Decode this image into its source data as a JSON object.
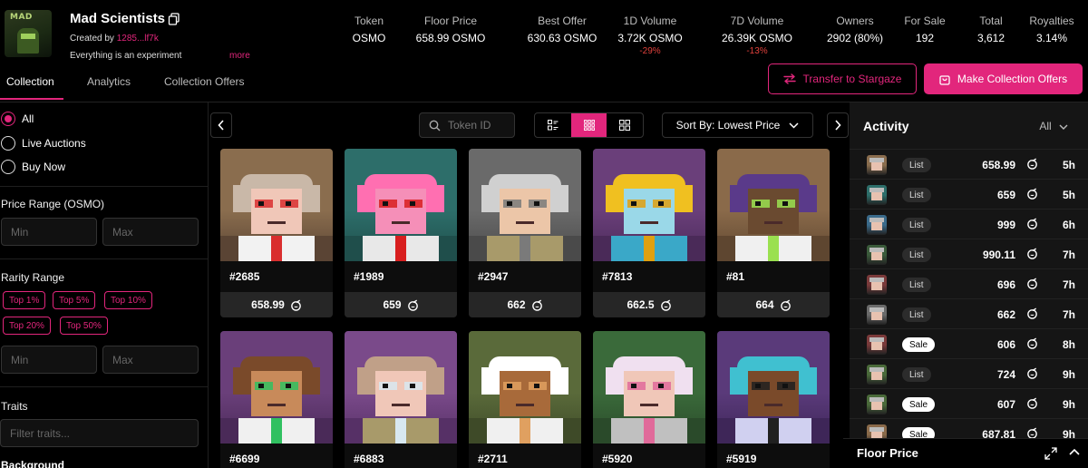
{
  "collection": {
    "name": "Mad Scientists",
    "created_prefix": "Created by",
    "creator": "1285...lf7k",
    "description": "Everything is an experiment",
    "more": "more",
    "logo_text": "MAD"
  },
  "stats": [
    {
      "label": "Token",
      "value": "OSMO",
      "change": ""
    },
    {
      "label": "Floor Price",
      "value": "658.99 OSMO",
      "change": ""
    },
    {
      "label": "Best Offer",
      "value": "630.63 OSMO",
      "change": ""
    },
    {
      "label": "1D Volume",
      "value": "3.72K OSMO",
      "change": "-29%"
    },
    {
      "label": "7D Volume",
      "value": "26.39K OSMO",
      "change": "-13%"
    },
    {
      "label": "Owners",
      "value": "2902 (80%)",
      "change": ""
    },
    {
      "label": "For Sale",
      "value": "192",
      "change": ""
    },
    {
      "label": "Total",
      "value": "3,612",
      "change": ""
    },
    {
      "label": "Royalties",
      "value": "3.14%",
      "change": ""
    }
  ],
  "tabs": [
    {
      "label": "Collection",
      "active": true
    },
    {
      "label": "Analytics",
      "active": false
    },
    {
      "label": "Collection Offers",
      "active": false
    }
  ],
  "buttons": {
    "transfer": "Transfer to Stargaze",
    "offers": "Make Collection Offers"
  },
  "sidebar": {
    "status_options": [
      "All",
      "Live Auctions",
      "Buy Now"
    ],
    "price_range_label": "Price Range (OSMO)",
    "rarity_range_label": "Rarity Range",
    "min_placeholder": "Min",
    "max_placeholder": "Max",
    "rarity_pills": [
      "Top 1%",
      "Top 5%",
      "Top 10%",
      "Top 20%",
      "Top 50%"
    ],
    "traits_label": "Traits",
    "traits_placeholder": "Filter traits...",
    "background_label": "Background"
  },
  "toolbar": {
    "search_placeholder": "Token ID",
    "sort_label": "Sort By: Lowest Price"
  },
  "cards": [
    {
      "name": "#2685",
      "price": "658.99",
      "bg": "#8a6d4e",
      "bg2": "#5a4434",
      "hair": "#c9b8a8",
      "skin": "#f0c7b8",
      "coat": "#f2f2f2",
      "acc": "#d92e2e"
    },
    {
      "name": "#1989",
      "price": "659",
      "bg": "#2d6e6a",
      "bg2": "#1f4e4b",
      "hair": "#ff6fb1",
      "skin": "#f58fb8",
      "coat": "#e8e8e8",
      "acc": "#d81e1e"
    },
    {
      "name": "#2947",
      "price": "662",
      "bg": "#6a6a6a",
      "bg2": "#4a4a4a",
      "hair": "#d0d0d0",
      "skin": "#ecc6a8",
      "coat": "#a89a6a",
      "acc": "#7a7a7a"
    },
    {
      "name": "#7813",
      "price": "662.5",
      "bg": "#6a3f7a",
      "bg2": "#4a2a58",
      "hair": "#f0c020",
      "skin": "#9ad8e8",
      "coat": "#3aa8c8",
      "acc": "#e0a010"
    },
    {
      "name": "#81",
      "price": "664",
      "bg": "#8a6a4a",
      "bg2": "#5e4630",
      "hair": "#5a3a8a",
      "skin": "#6a4a30",
      "coat": "#f0f0f0",
      "acc": "#9ae050"
    },
    {
      "name": "#6699",
      "price": "",
      "bg": "#6a3f7a",
      "bg2": "#4a2a58",
      "hair": "#7a4a2a",
      "skin": "#c88a5a",
      "coat": "#f0f0f0",
      "acc": "#30c060"
    },
    {
      "name": "#6883",
      "price": "",
      "bg": "#7a4a8a",
      "bg2": "#563066",
      "hair": "#c0a088",
      "skin": "#f0c7b8",
      "coat": "#a89a6a",
      "acc": "#d8e8f0"
    },
    {
      "name": "#2711",
      "price": "",
      "bg": "#5a6a3a",
      "bg2": "#3e4a28",
      "hair": "#ffffff",
      "skin": "#a86a3a",
      "coat": "#f0f0f0",
      "acc": "#e0a060"
    },
    {
      "name": "#5920",
      "price": "",
      "bg": "#3a6a3a",
      "bg2": "#2a4a2a",
      "hair": "#f0e0f0",
      "skin": "#f0c7b8",
      "coat": "#c0c0c0",
      "acc": "#e06a9a"
    },
    {
      "name": "#5919",
      "price": "",
      "bg": "#5a3a7a",
      "bg2": "#3e2658",
      "hair": "#40c0d0",
      "skin": "#7a4a2a",
      "coat": "#d0d0f0",
      "acc": "#202020"
    }
  ],
  "activity": {
    "title": "Activity",
    "filter": "All",
    "rows": [
      {
        "type": "List",
        "price": "658.99",
        "time": "5h",
        "color": "#8a6d4e"
      },
      {
        "type": "List",
        "price": "659",
        "time": "5h",
        "color": "#2d6e6a"
      },
      {
        "type": "List",
        "price": "999",
        "time": "6h",
        "color": "#3a6a8a"
      },
      {
        "type": "List",
        "price": "990.11",
        "time": "7h",
        "color": "#3a5a3a"
      },
      {
        "type": "List",
        "price": "696",
        "time": "7h",
        "color": "#7a3a3a"
      },
      {
        "type": "List",
        "price": "662",
        "time": "7h",
        "color": "#6a6a6a"
      },
      {
        "type": "Sale",
        "price": "606",
        "time": "8h",
        "color": "#7a3a3a"
      },
      {
        "type": "List",
        "price": "724",
        "time": "9h",
        "color": "#4a6a3a"
      },
      {
        "type": "Sale",
        "price": "607",
        "time": "9h",
        "color": "#4a6a3a"
      },
      {
        "type": "Sale",
        "price": "687.81",
        "time": "9h",
        "color": "#8a6a4a"
      }
    ]
  },
  "floor_panel": {
    "title": "Floor Price"
  },
  "colors": {
    "accent": "#e2267c",
    "negative": "#e0413c",
    "background": "#000000",
    "panel": "#151515"
  }
}
